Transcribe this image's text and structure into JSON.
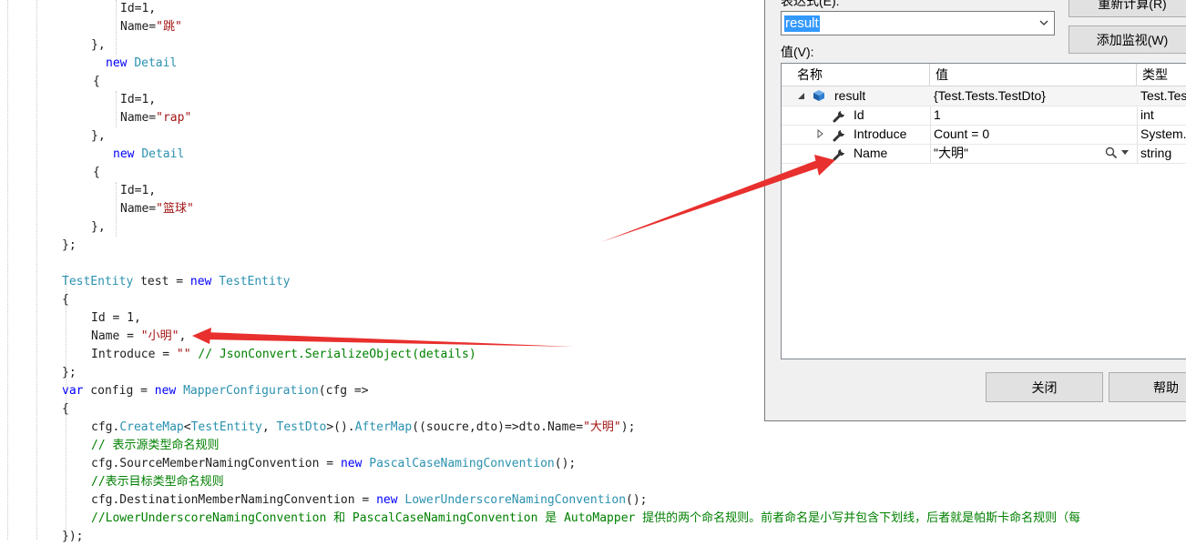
{
  "editor": {
    "lines": {
      "l1": "Id=1,",
      "l2_a": "Name=",
      "l2_b": "\"跳\"",
      "l3": "},",
      "l4_new": "new",
      "l4_type": "Detail",
      "l5": "{",
      "l6": "Id=1,",
      "l7_a": "Name=",
      "l7_b": "\"rap\"",
      "l8": "},",
      "l9_new": "new",
      "l9_type": "Detail",
      "l10": "{",
      "l11": "Id=1,",
      "l12_a": "Name=",
      "l12_b": "\"篮球\"",
      "l13": "},",
      "l14": "};",
      "l16_type": "TestEntity",
      "l16_mid": " test = ",
      "l16_new": "new",
      "l16_type2": "TestEntity",
      "l17": "{",
      "l18": "Id = 1,",
      "l19_a": "Name = ",
      "l19_b": "\"小明\"",
      "l19_c": ",",
      "l20_a": "Introduce = ",
      "l20_b": "\"\"",
      "l20_c": " // JsonConvert.SerializeObject(details)",
      "l21": "};",
      "l22_var": "var",
      "l22_mid": " config = ",
      "l22_new": "new",
      "l22_type": "MapperConfiguration",
      "l22_end": "(cfg =>",
      "l23": "{",
      "l24_a": "cfg.",
      "l24_b": "CreateMap",
      "l24_c": "<",
      "l24_d": "TestEntity",
      "l24_e": ", ",
      "l24_f": "TestDto",
      "l24_g": ">().",
      "l24_h": "AfterMap",
      "l24_i": "((soucre,dto)=>dto.Name=",
      "l24_j": "\"大明\"",
      "l24_k": ");",
      "l25": "// 表示源类型命名规则",
      "l26_a": "cfg.SourceMemberNamingConvention = ",
      "l26_new": "new",
      "l26_type": "PascalCaseNamingConvention",
      "l26_end": "();",
      "l27": "//表示目标类型命名规则",
      "l28_a": "cfg.DestinationMemberNamingConvention = ",
      "l28_new": "new",
      "l28_type": "LowerUnderscoreNamingConvention",
      "l28_end": "();",
      "l29": "//LowerUnderscoreNamingConvention 和 PascalCaseNamingConvention 是 AutoMapper 提供的两个命名规则。前者命名是小写并包含下划线，后者就是帕斯卡命名规则（每",
      "l30": "});"
    }
  },
  "dialog": {
    "expression_label": "表达式(E):",
    "expression_value": "result",
    "recalc_button": "重新计算(R)",
    "add_watch_button": "添加监视(W)",
    "value_label": "值(V):",
    "columns": {
      "name": "名称",
      "value": "值",
      "type": "类型"
    },
    "rows": [
      {
        "name": "result",
        "value": "{Test.Tests.TestDto}",
        "type": "Test.Tests",
        "icon": "object-icon",
        "expander": "expanded"
      },
      {
        "name": "Id",
        "value": "1",
        "type": "int",
        "icon": "wrench-icon",
        "expander": "none"
      },
      {
        "name": "Introduce",
        "value": "Count = 0",
        "type": "System.",
        "icon": "wrench-icon",
        "expander": "collapsed"
      },
      {
        "name": "Name",
        "value": "\"大明\"",
        "type": "string",
        "icon": "wrench-icon",
        "expander": "none"
      }
    ],
    "close_button": "关闭",
    "help_button": "帮助"
  },
  "colors": {
    "keyword": "#0000ff",
    "type": "#2b91af",
    "string": "#a31515",
    "comment": "#008000",
    "annotation_arrow": "#e8302e",
    "selection": "#3399ff"
  }
}
